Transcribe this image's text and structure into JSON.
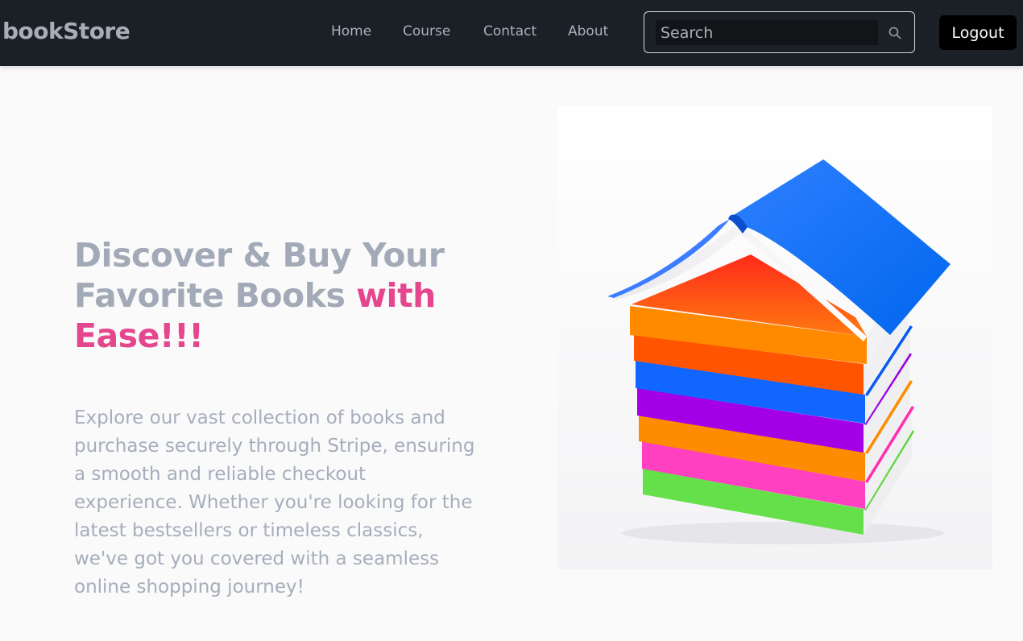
{
  "brand": {
    "name": "bookStore"
  },
  "nav": {
    "items": [
      {
        "label": "Home"
      },
      {
        "label": "Course"
      },
      {
        "label": "Contact"
      },
      {
        "label": "About"
      }
    ]
  },
  "search": {
    "placeholder": "Search",
    "icon": "search-icon"
  },
  "auth": {
    "logout_label": "Logout"
  },
  "hero": {
    "title_main": "Discover & Buy Your Favorite Books ",
    "title_accent": "with Ease!!!",
    "description": "Explore our vast collection of books and purchase securely through Stripe, ensuring a smooth and reliable checkout experience. Whether you're looking for the latest bestsellers or timeless classics, we've got you covered with a seamless online shopping journey!",
    "image": "stack-of-colorful-books-with-open-book-roof"
  },
  "colors": {
    "navbar_bg": "#1b1f26",
    "accent": "#e5478e",
    "text_muted": "#a3aab7",
    "page_bg": "#fafafa"
  }
}
